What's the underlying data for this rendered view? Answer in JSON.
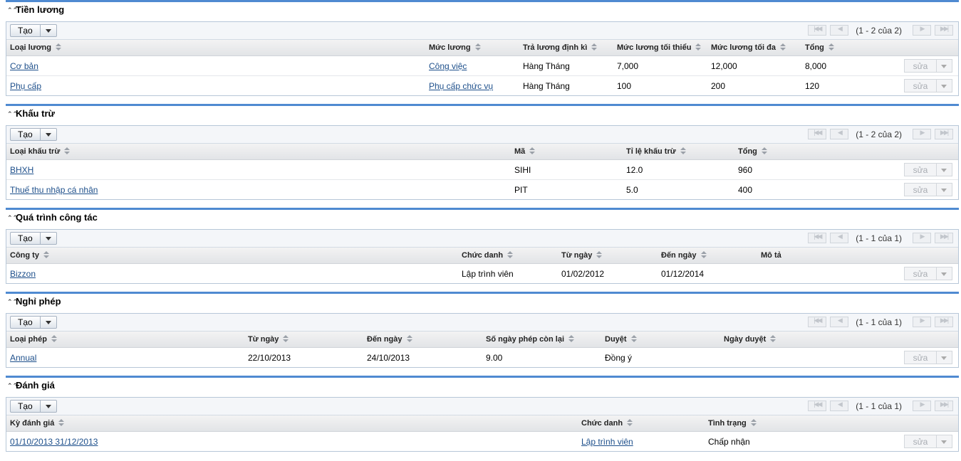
{
  "common": {
    "create_label": "Tạo",
    "edit_label": "sửa"
  },
  "salary": {
    "title": "Tiền lương",
    "pager": "(1 - 2 của 2)",
    "headers": [
      "Loại lương",
      "Mức lương",
      "Trả lương định kì",
      "Mức lương tối thiểu",
      "Mức lương tối đa",
      "Tổng"
    ],
    "rows": [
      [
        "Cơ bản",
        "Công việc",
        "Hàng Tháng",
        "7,000",
        "12,000",
        "8,000"
      ],
      [
        "Phụ cấp",
        "Phụ cấp chức vụ",
        "Hàng Tháng",
        "100",
        "200",
        "120"
      ]
    ]
  },
  "deduction": {
    "title": "Khấu trừ",
    "pager": "(1 - 2 của 2)",
    "headers": [
      "Loại khấu trừ",
      "Mã",
      "Tỉ lệ khấu trừ",
      "Tổng"
    ],
    "rows": [
      [
        "BHXH",
        "SIHI",
        "12.0",
        "960"
      ],
      [
        "Thuế thu nhập cá nhân",
        "PIT",
        "5.0",
        "400"
      ]
    ]
  },
  "work": {
    "title": "Quá trình công tác",
    "pager": "(1 - 1 của 1)",
    "headers": [
      "Công ty",
      "Chức danh",
      "Từ ngày",
      "Đến ngày",
      "Mô tả"
    ],
    "rows": [
      [
        "Bizzon",
        "Lập trình viên",
        "01/02/2012",
        "01/12/2014",
        ""
      ]
    ]
  },
  "leave": {
    "title": "Nghỉ phép",
    "pager": "(1 - 1 của 1)",
    "headers": [
      "Loại phép",
      "Từ ngày",
      "Đến ngày",
      "Số ngày phép còn lại",
      "Duyệt",
      "Ngày duyệt"
    ],
    "rows": [
      [
        "Annual",
        "22/10/2013",
        "24/10/2013",
        "9.00",
        "Đồng ý",
        ""
      ]
    ]
  },
  "review": {
    "title": "Đánh giá",
    "pager": "(1 - 1 của 1)",
    "headers": [
      "Kỳ đánh giá",
      "Chức danh",
      "Tình trạng"
    ],
    "rows": [
      [
        "01/10/2013  31/12/2013",
        "Lập trình viên",
        "Chấp nhận"
      ]
    ]
  }
}
